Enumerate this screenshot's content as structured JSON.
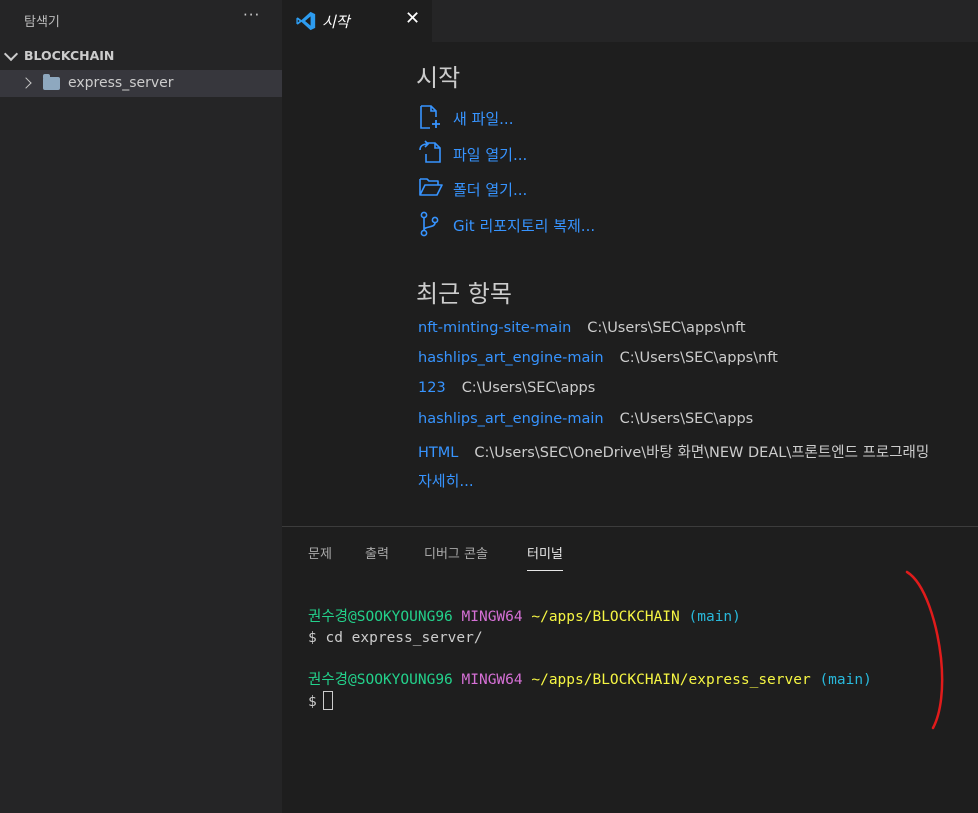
{
  "sidebar": {
    "title": "탐색기",
    "more": "···",
    "section": "BLOCKCHAIN",
    "items": [
      {
        "label": "express_server",
        "icon": "folder-icon"
      }
    ]
  },
  "tab": {
    "label": "시작",
    "close": "✕"
  },
  "welcome": {
    "start_heading": "시작",
    "actions": [
      {
        "label": "새 파일...",
        "icon": "new-file-icon"
      },
      {
        "label": "파일 열기...",
        "icon": "open-file-icon"
      },
      {
        "label": "폴더 열기...",
        "icon": "open-folder-icon"
      },
      {
        "label": "Git 리포지토리 복제...",
        "icon": "git-clone-icon"
      }
    ],
    "recent_heading": "최근 항목",
    "recent": [
      {
        "name": "nft-minting-site-main",
        "path": "C:\\Users\\SEC\\apps\\nft"
      },
      {
        "name": "hashlips_art_engine-main",
        "path": "C:\\Users\\SEC\\apps\\nft"
      },
      {
        "name": "123",
        "path": "C:\\Users\\SEC\\apps"
      },
      {
        "name": "hashlips_art_engine-main",
        "path": "C:\\Users\\SEC\\apps"
      },
      {
        "name": "HTML",
        "path": "C:\\Users\\SEC\\OneDrive\\바탕 화면\\NEW DEAL\\프론트엔드 프로그래밍"
      }
    ],
    "more": "자세히..."
  },
  "panel": {
    "tabs": [
      "문제",
      "출력",
      "디버그 콘솔",
      "터미널"
    ],
    "active_tab": "터미널"
  },
  "terminal": {
    "user": "권수경@SOOKYOUNG96",
    "mingw": "MINGW64",
    "path1": "~/apps/BLOCKCHAIN",
    "branch": "(main)",
    "command": "$ cd express_server/",
    "path2": "~/apps/BLOCKCHAIN/express_server",
    "prompt": "$"
  },
  "colors": {
    "link": "#3794ff",
    "user": "#23d18b",
    "mingw": "#d670d6",
    "path": "#f5f543",
    "branch": "#29b8db",
    "annotation": "#e01b1b"
  }
}
